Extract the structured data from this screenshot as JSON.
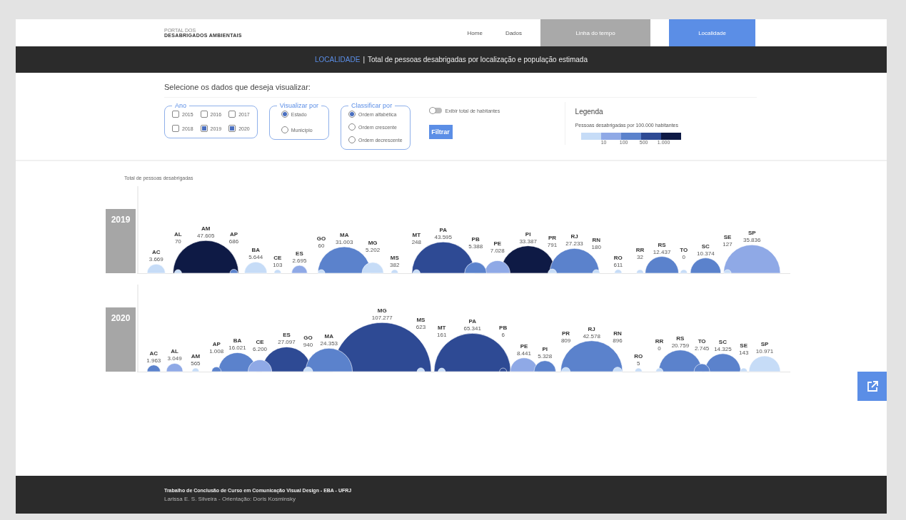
{
  "header": {
    "logo_top": "PORTAL DOS",
    "logo_bottom": "DESABRIGADOS AMBIENTAIS",
    "nav": [
      {
        "label": "Home",
        "selected": false,
        "disabled": false
      },
      {
        "label": "Dados",
        "selected": false,
        "disabled": false
      },
      {
        "label": "Linha do tempo",
        "selected": false,
        "disabled": true
      },
      {
        "label": "Localidade",
        "selected": true,
        "disabled": false
      }
    ]
  },
  "title_bar": {
    "section": "LOCALIDADE",
    "separator": "|",
    "title": "Total de pessoas desabrigadas por localização e população estimada"
  },
  "filters": {
    "prompt": "Selecione os dados que deseja visualizar:",
    "year_group": {
      "label": "Ano",
      "options": [
        {
          "label": "2015",
          "checked": false
        },
        {
          "label": "2016",
          "checked": false
        },
        {
          "label": "2017",
          "checked": false
        },
        {
          "label": "2018",
          "checked": false
        },
        {
          "label": "2019",
          "checked": true
        },
        {
          "label": "2020",
          "checked": true
        }
      ]
    },
    "view_group": {
      "label": "Visualizar por",
      "options": [
        {
          "label": "Estado",
          "selected": true
        },
        {
          "label": "Município",
          "selected": false
        }
      ]
    },
    "sort_group": {
      "label": "Classificar por",
      "options": [
        {
          "label": "Ordem alfabética",
          "selected": true
        },
        {
          "label": "Ordem crescente",
          "selected": false
        },
        {
          "label": "Ordem decrescente",
          "selected": false
        }
      ]
    },
    "toggle": {
      "label": "Exibir total de habitantes",
      "on": false
    },
    "button": "Filtrar",
    "legend": {
      "title": "Legenda",
      "subtitle": "Pessoas desabrigadas por 100.000 habitantes",
      "swatches": [
        {
          "color": "#c6dcf7"
        },
        {
          "color": "#8fa9e6"
        },
        {
          "color": "#5b82cc"
        },
        {
          "color": "#2e4a94"
        },
        {
          "color": "#0e1a45"
        }
      ],
      "ticks": [
        "10",
        "100",
        "500",
        "1.000"
      ]
    }
  },
  "chart_title": "Total de pessoas desabrigadas",
  "years": [
    {
      "year": "2019",
      "bubbles": [
        {
          "state": "AC",
          "value": "3.669",
          "color": "#c6dcf7"
        },
        {
          "state": "AL",
          "value": "70",
          "color": "#c6dcf7"
        },
        {
          "state": "AM",
          "value": "47.605",
          "color": "#0e1a45"
        },
        {
          "state": "AP",
          "value": "686",
          "color": "#5b82cc"
        },
        {
          "state": "BA",
          "value": "5.644",
          "color": "#c6dcf7"
        },
        {
          "state": "CE",
          "value": "103",
          "color": "#c6dcf7"
        },
        {
          "state": "ES",
          "value": "2.695",
          "color": "#8fa9e6"
        },
        {
          "state": "GO",
          "value": "60",
          "color": "#c6dcf7"
        },
        {
          "state": "MA",
          "value": "31.003",
          "color": "#5b82cc"
        },
        {
          "state": "MG",
          "value": "5.202",
          "color": "#c6dcf7"
        },
        {
          "state": "MS",
          "value": "382",
          "color": "#c6dcf7"
        },
        {
          "state": "MT",
          "value": "248",
          "color": "#c6dcf7"
        },
        {
          "state": "PA",
          "value": "43.595",
          "color": "#2e4a94"
        },
        {
          "state": "PB",
          "value": "5.388",
          "color": "#5b82cc"
        },
        {
          "state": "PE",
          "value": "7.028",
          "color": "#8fa9e6"
        },
        {
          "state": "PI",
          "value": "33.387",
          "color": "#0e1a45"
        },
        {
          "state": "PR",
          "value": "791",
          "color": "#c6dcf7"
        },
        {
          "state": "RJ",
          "value": "27.233",
          "color": "#5b82cc"
        },
        {
          "state": "RN",
          "value": "180",
          "color": "#c6dcf7"
        },
        {
          "state": "RO",
          "value": "611",
          "color": "#c6dcf7"
        },
        {
          "state": "RR",
          "value": "32",
          "color": "#c6dcf7"
        },
        {
          "state": "RS",
          "value": "12.437",
          "color": "#5b82cc"
        },
        {
          "state": "TO",
          "value": "0",
          "color": "#c6dcf7"
        },
        {
          "state": "SC",
          "value": "10.374",
          "color": "#5b82cc"
        },
        {
          "state": "SE",
          "value": "127",
          "color": "#c6dcf7"
        },
        {
          "state": "SP",
          "value": "35.836",
          "color": "#8fa9e6"
        }
      ]
    },
    {
      "year": "2020",
      "bubbles": [
        {
          "state": "AC",
          "value": "1.963",
          "color": "#5b82cc"
        },
        {
          "state": "AL",
          "value": "3.049",
          "color": "#8fa9e6"
        },
        {
          "state": "AM",
          "value": "565",
          "color": "#c6dcf7"
        },
        {
          "state": "AP",
          "value": "1.008",
          "color": "#5b82cc"
        },
        {
          "state": "BA",
          "value": "16.021",
          "color": "#5b82cc"
        },
        {
          "state": "CE",
          "value": "6.200",
          "color": "#8fa9e6"
        },
        {
          "state": "ES",
          "value": "27.097",
          "color": "#2e4a94"
        },
        {
          "state": "GO",
          "value": "940",
          "color": "#c6dcf7"
        },
        {
          "state": "MA",
          "value": "24.353",
          "color": "#5b82cc"
        },
        {
          "state": "MG",
          "value": "107.277",
          "color": "#2e4a94"
        },
        {
          "state": "MS",
          "value": "623",
          "color": "#c6dcf7"
        },
        {
          "state": "MT",
          "value": "161",
          "color": "#c6dcf7"
        },
        {
          "state": "PA",
          "value": "65.341",
          "color": "#2e4a94"
        },
        {
          "state": "PB",
          "value": "6",
          "color": "#2e4a94"
        },
        {
          "state": "PE",
          "value": "8.441",
          "color": "#8fa9e6"
        },
        {
          "state": "PI",
          "value": "5.328",
          "color": "#5b82cc"
        },
        {
          "state": "PR",
          "value": "809",
          "color": "#c6dcf7"
        },
        {
          "state": "RJ",
          "value": "42.578",
          "color": "#5b82cc"
        },
        {
          "state": "RN",
          "value": "896",
          "color": "#c6dcf7"
        },
        {
          "state": "RO",
          "value": "5",
          "color": "#c6dcf7"
        },
        {
          "state": "RR",
          "value": "0",
          "color": "#c6dcf7"
        },
        {
          "state": "RS",
          "value": "20.759",
          "color": "#5b82cc"
        },
        {
          "state": "TO",
          "value": "2.745",
          "color": "#5b82cc"
        },
        {
          "state": "SC",
          "value": "14.325",
          "color": "#5b82cc"
        },
        {
          "state": "SE",
          "value": "143",
          "color": "#c6dcf7"
        },
        {
          "state": "SP",
          "value": "10.971",
          "color": "#c6dcf7"
        }
      ]
    }
  ],
  "footer": {
    "line1": "Trabalho de Conclusão de Curso em Comunicação Visual Design - EBA - UFRJ",
    "line2": "Larissa E. S. Silveira - Orientação: Doris Kosminsky"
  }
}
